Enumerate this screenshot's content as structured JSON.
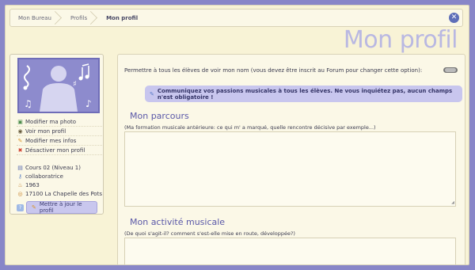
{
  "breadcrumb": [
    "Mon Bureau",
    "Profils",
    "Mon profil"
  ],
  "page_title": "Mon profil",
  "sidebar": {
    "menu": [
      {
        "icon": "photo-icon",
        "label": "Modifier ma photo"
      },
      {
        "icon": "eye-icon",
        "label": "Voir mon profil"
      },
      {
        "icon": "pencil-icon",
        "label": "Modifier mes infos"
      },
      {
        "icon": "cross-icon",
        "label": "Désactiver mon profil"
      }
    ],
    "info": [
      {
        "icon": "books-icon",
        "label": "Cours 02 (Niveau 1)"
      },
      {
        "icon": "key-icon",
        "label": "collaboratrice"
      },
      {
        "icon": "cake-icon",
        "label": "1963"
      },
      {
        "icon": "location-icon",
        "label": "17100 La Chapelle des Pots"
      }
    ],
    "update_label": "Mettre à jour le profil"
  },
  "main": {
    "permission_text": "Permettre à tous les élèves de voir mon nom (vous devez être inscrit au Forum pour changer cette option):",
    "notice": "Communiquez vos passions musicales à tous les élèves. Ne vous inquiétez pas, aucun champs n'est obligatoire !",
    "sections": [
      {
        "title": "Mon parcours",
        "hint": "(Ma formation musicale antérieure: ce qui m' a marqué, quelle rencontre décisive par exemple...)"
      },
      {
        "title": "Mon activité musicale",
        "hint": "(De quoi s'agit-il? comment s'est-elle mise en route, développée?)"
      }
    ]
  },
  "colors": {
    "accent": "#8d8bcd",
    "background": "#f8f3d6",
    "title": "#b9b8e2"
  }
}
